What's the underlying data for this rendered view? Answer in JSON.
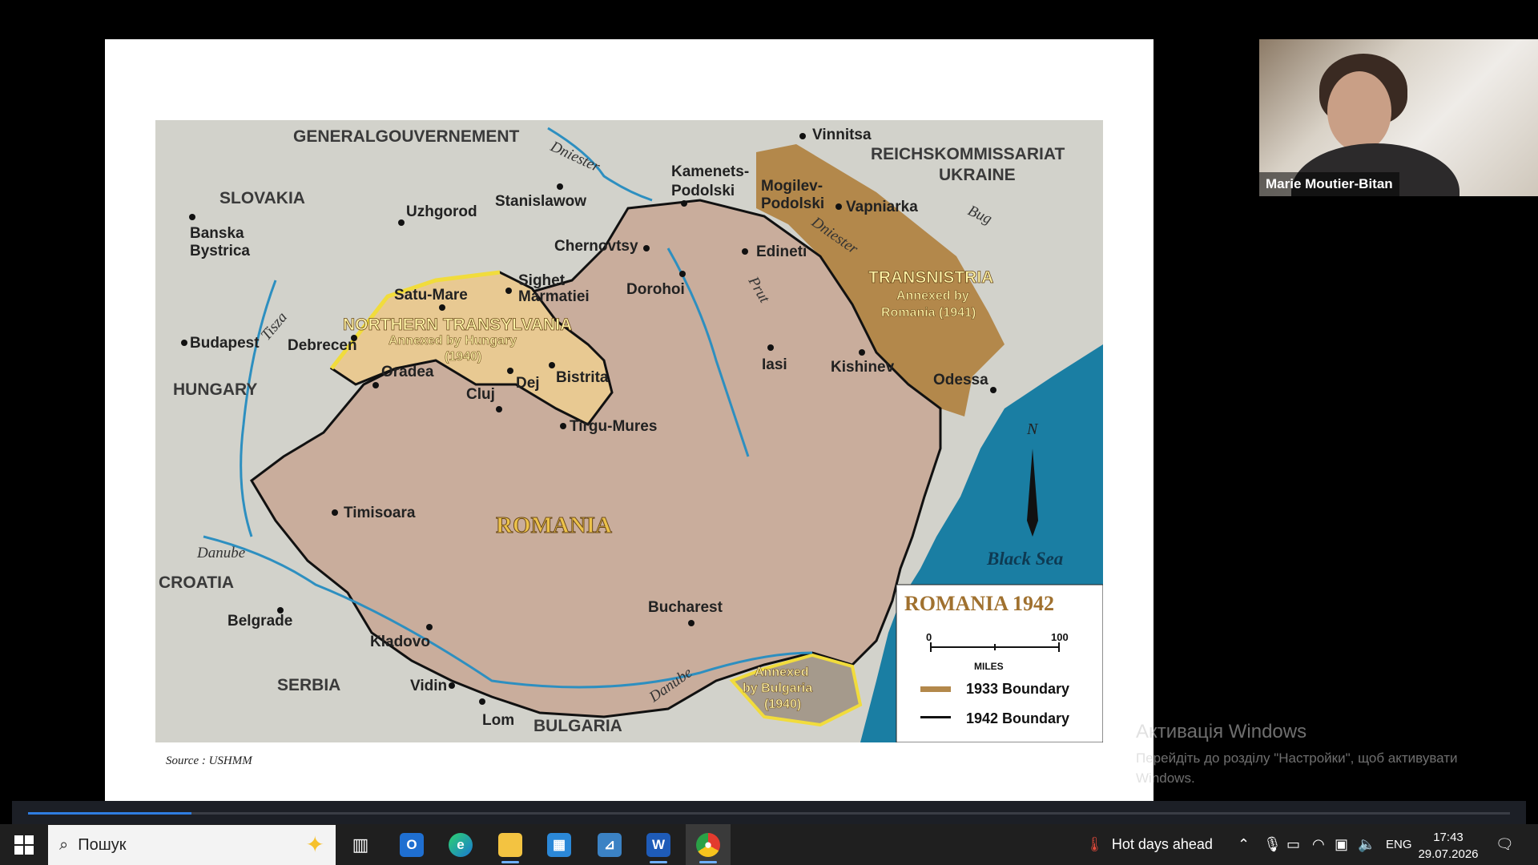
{
  "slide": {
    "source": "Source : USHMM",
    "map": {
      "title": "ROMANIA 1942",
      "scale_min": "0",
      "scale_max": "100",
      "scale_unit": "MILES",
      "legend_1933": "1933 Boundary",
      "legend_1942": "1942 Boundary",
      "colors": {
        "romania": "#c9ad9c",
        "north_transylvania": "#e8c992",
        "transnistria": "#b3884b",
        "sea": "#1a7ea3",
        "land": "#d2d2cb",
        "border_1940": "#f1dc3c"
      },
      "regions": {
        "generalgouvernement": "GENERALGOUVERNEMENT",
        "reichskommissariat": "REICHSKOMMISSARIAT",
        "ukraine": "UKRAINE",
        "slovakia": "SLOVAKIA",
        "hungary": "HUNGARY",
        "croatia": "CROATIA",
        "serbia": "SERBIA",
        "bulgaria": "BULGARIA",
        "romania": "ROMANIA",
        "north_trans": "NORTHERN TRANSYLVANIA",
        "north_trans_note1": "Annexed by Hungary",
        "north_trans_note2": "(1940)",
        "transnistria": "TRANSNISTRIA",
        "transnistria_note1": "Annexed by",
        "transnistria_note2": "Romania (1941)",
        "bulgaria_note1": "Annexed",
        "bulgaria_note2": "by Bulgaria",
        "bulgaria_note3": "(1940)",
        "black_sea": "Black Sea"
      },
      "rivers": {
        "dniester1": "Dniester",
        "dniester2": "Dniester",
        "bug": "Bug",
        "prut": "Prut",
        "tisza": "Tisza",
        "danube1": "Danube",
        "danube2": "Danube"
      },
      "cities": {
        "vinnitsa": "Vinnitsa",
        "kamenets": "Kamenets-",
        "podolski": "Podolski",
        "mogilev": "Mogilev-",
        "mogilev2": "Podolski",
        "vapniarka": "Vapniarka",
        "stanislawow": "Stanislawow",
        "uzhgorod": "Uzhgorod",
        "banska": "Banska",
        "bystrica": "Bystrica",
        "chernovtsy": "Chernovtsy",
        "edineti": "Edineti",
        "dorohoi": "Dorohoi",
        "sighet": "Sighet",
        "marmatiei": "Marmatiei",
        "satu_mare": "Satu-Mare",
        "budapest": "Budapest",
        "debrecen": "Debrecen",
        "oradea": "Oradea",
        "dej": "Dej",
        "bistrita": "Bistrita",
        "cluj": "Cluj",
        "tirgu": "Tirgu-Mures",
        "iasi": "Iasi",
        "kishinev": "Kishinev",
        "odessa": "Odessa",
        "timisoara": "Timisoara",
        "bucharest": "Bucharest",
        "belgrade": "Belgrade",
        "kladovo": "Kladovo",
        "vidin": "Vidin",
        "lom": "Lom"
      },
      "compass": "N"
    }
  },
  "webcam": {
    "name": "Marie Moutier-Bitan"
  },
  "activation": {
    "title": "Активація Windows",
    "subtitle": "Перейдіть до розділу \"Настройки\", щоб активувати Windows."
  },
  "progress": {
    "fraction": 0.11
  },
  "taskbar": {
    "search_placeholder": "Пошук",
    "apps": [
      "task-view",
      "outlook",
      "edge",
      "file-explorer",
      "microsoft-store",
      "app-launcher",
      "word",
      "chrome"
    ],
    "weather": "Hot days ahead",
    "language": "ENG",
    "time": "17:43",
    "date": "29.07.2026"
  }
}
